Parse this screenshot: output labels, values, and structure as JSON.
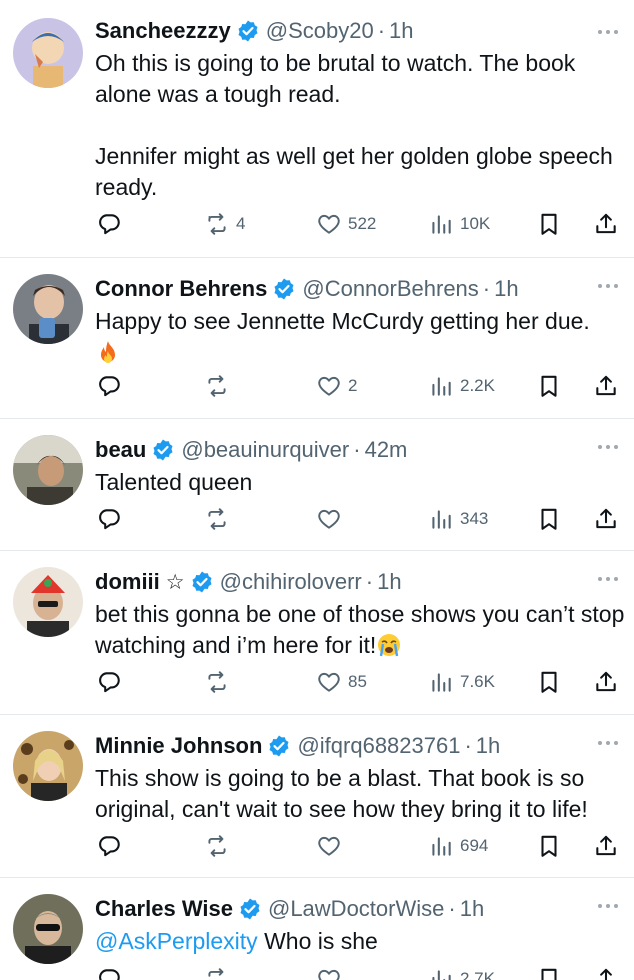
{
  "tweets": [
    {
      "name": "Sancheezzzy",
      "has_star": false,
      "handle": "@Scoby20",
      "time": "1h",
      "paragraphs": [
        "Oh this is going to be brutal to watch. The book alone was a tough read.",
        "Jennifer might as well get her golden globe speech ready."
      ],
      "mention": "",
      "replies": "",
      "reposts": "4",
      "likes": "522",
      "views": "10K"
    },
    {
      "name": "Connor Behrens",
      "has_star": false,
      "handle": "@ConnorBehrens",
      "time": "1h",
      "paragraphs": [
        "Happy to see Jennette McCurdy getting her due."
      ],
      "emoji": "fire",
      "replies": "",
      "reposts": "",
      "likes": "2",
      "views": "2.2K"
    },
    {
      "name": "beau",
      "has_star": false,
      "handle": "@beauinurquiver",
      "time": "42m",
      "paragraphs": [
        "Talented queen"
      ],
      "replies": "",
      "reposts": "",
      "likes": "",
      "views": "343"
    },
    {
      "name": "domiii",
      "has_star": true,
      "star": "☆",
      "handle": "@chihiroloverr",
      "time": "1h",
      "paragraphs": [
        "bet this gonna be one of those shows you can’t stop watching and i’m here for it!"
      ],
      "emoji": "loudly-crying-face",
      "replies": "",
      "reposts": "",
      "likes": "85",
      "views": "7.6K"
    },
    {
      "name": "Minnie Johnson",
      "has_star": false,
      "handle": "@ifqrq68823761",
      "time": "1h",
      "paragraphs": [
        "This show is going to be a blast. That book is so original, can't wait to see how they bring it to life!"
      ],
      "replies": "",
      "reposts": "",
      "likes": "",
      "views": "694"
    },
    {
      "name": "Charles Wise",
      "has_star": false,
      "handle": "@LawDoctorWise",
      "time": "1h",
      "mention": "@AskPerplexity",
      "paragraphs": [
        "Who is she"
      ],
      "replies": "",
      "reposts": "",
      "likes": "",
      "views": "2.7K"
    }
  ],
  "icons": {
    "verified": "verified-badge-icon",
    "more": "more-options-icon",
    "reply": "reply-icon",
    "repost": "repost-icon",
    "like": "heart-icon",
    "views": "views-icon",
    "bookmark": "bookmark-icon",
    "share": "share-icon"
  },
  "colors": {
    "verified": "#1d9bf0",
    "mention": "#1d9bf0",
    "secondary_text": "#536471",
    "primary_text": "#0f1419",
    "divider": "#e6e9eb"
  }
}
